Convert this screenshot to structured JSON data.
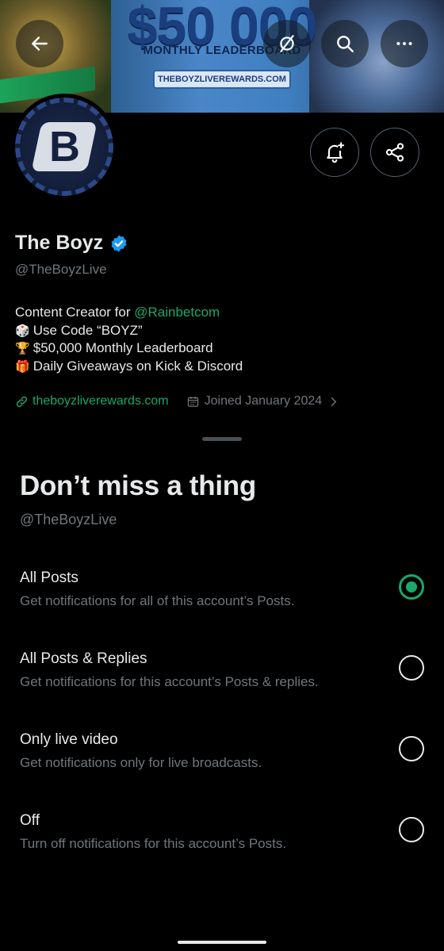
{
  "banner": {
    "headline": "$50 000",
    "subheadline": "MONTHLY LEADERBOARD",
    "url": "THEBOYZLIVEREWARDS.COM"
  },
  "top_bar": {
    "back_icon": "arrow-left-icon",
    "grok_icon": "grok-icon",
    "search_icon": "search-icon",
    "more_icon": "more-horizontal-icon"
  },
  "profile": {
    "name": "The Boyz",
    "handle": "@TheBoyzLive",
    "bio": {
      "line1_prefix": "Content Creator for ",
      "line1_mention": "@Rainbetcom",
      "line2_emoji": "🎲",
      "line2_text": "Use Code “BOYZ”",
      "line3_emoji": "🏆",
      "line3_text": "$50,000 Monthly Leaderboard",
      "line4_emoji": "🎁",
      "line4_text": "Daily Giveaways on Kick & Discord"
    },
    "website": "theboyzliverewards.com",
    "joined": "Joined January 2024"
  },
  "sheet": {
    "title": "Don’t miss a thing",
    "subtitle": "@TheBoyzLive",
    "options": [
      {
        "label": "All Posts",
        "description": "Get notifications for all of this account’s Posts.",
        "selected": true
      },
      {
        "label": "All Posts & Replies",
        "description": "Get notifications for this account’s Posts & replies.",
        "selected": false
      },
      {
        "label": "Only live video",
        "description": "Get notifications only for live broadcasts.",
        "selected": false
      },
      {
        "label": "Off",
        "description": "Turn off notifications for this account’s Posts.",
        "selected": false
      }
    ]
  },
  "colors": {
    "accent": "#1ba86a",
    "background": "#000000",
    "secondary_text": "#71767b",
    "verified": "#1d9bf0"
  }
}
